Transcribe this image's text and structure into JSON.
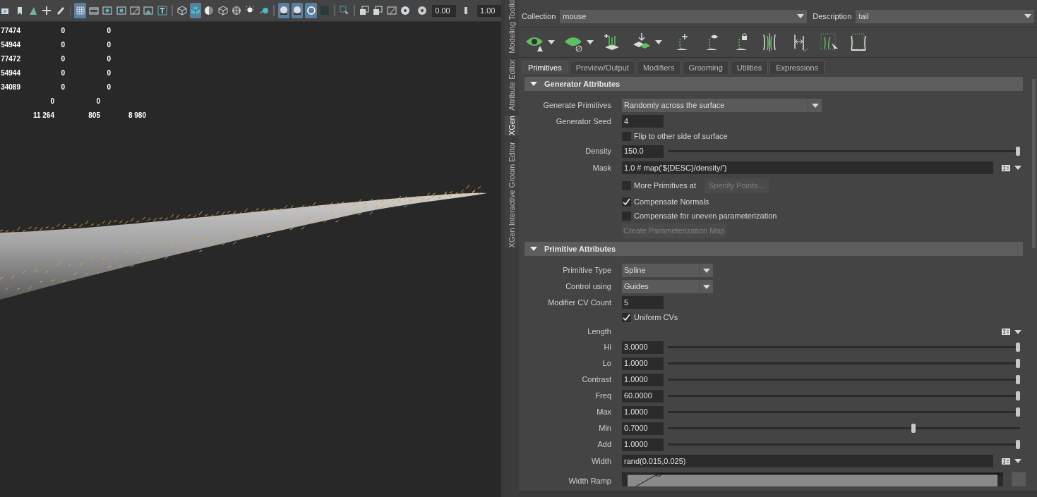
{
  "viewport": {
    "toolbar": {
      "buttons": [
        {
          "kind": "camera",
          "selected": false
        },
        {
          "kind": "bookmark",
          "selected": false
        },
        {
          "kind": "tool",
          "selected": false
        },
        {
          "kind": "move",
          "selected": false
        },
        {
          "kind": "brush",
          "selected": false
        },
        {
          "kind": "grid",
          "selected": true
        },
        {
          "kind": "film",
          "selected": false
        },
        {
          "kind": "dot",
          "selected": false
        },
        {
          "kind": "dot",
          "selected": false
        },
        {
          "kind": "frame",
          "selected": false
        },
        {
          "kind": "image",
          "selected": false
        },
        {
          "kind": "text",
          "selected": false
        },
        {
          "kind": "wire",
          "selected": false
        },
        {
          "kind": "cube",
          "selected": true
        },
        {
          "kind": "half",
          "selected": false
        },
        {
          "kind": "wire",
          "selected": false
        },
        {
          "kind": "checker",
          "selected": false
        },
        {
          "kind": "light",
          "selected": false
        },
        {
          "kind": "ball",
          "selected": false
        },
        {
          "kind": "sphere",
          "selected": true
        },
        {
          "kind": "sphere",
          "selected": true
        },
        {
          "kind": "ring",
          "selected": true
        },
        {
          "kind": "square",
          "selected": false
        },
        {
          "kind": "select",
          "selected": false
        },
        {
          "kind": "copy",
          "selected": false
        },
        {
          "kind": "copy",
          "selected": false
        },
        {
          "kind": "frame",
          "selected": false
        },
        {
          "kind": "aperture",
          "selected": false
        }
      ],
      "fields": [
        "0.00",
        "1.00"
      ]
    },
    "stats": [
      {
        "kind": "object",
        "cells": [
          "77474",
          "0",
          "0"
        ]
      },
      {
        "kind": "object",
        "cells": [
          "54944",
          "0",
          "0"
        ]
      },
      {
        "kind": "object",
        "cells": [
          "77472",
          "0",
          "0"
        ]
      },
      {
        "kind": "object",
        "cells": [
          "54944",
          "0",
          "0"
        ]
      },
      {
        "kind": "object",
        "cells": [
          "34089",
          "0",
          "0"
        ]
      },
      {
        "kind": "summary",
        "cells": [
          "0",
          "0"
        ]
      },
      {
        "kind": "summary",
        "cells": [
          "11 264",
          "805",
          "8 980"
        ]
      }
    ]
  },
  "side_tabs": [
    {
      "label": "Modeling Toolki",
      "selected": false
    },
    {
      "label": "Attribute Editor",
      "selected": false
    },
    {
      "label": "XGen",
      "selected": true
    },
    {
      "label": "XGen Interactive Groom Editor",
      "selected": false
    }
  ],
  "xgen": {
    "collection": {
      "label": "Collection",
      "value": "mouse"
    },
    "description": {
      "label": "Description",
      "value": "tail"
    },
    "toolbar": [
      {
        "kind": "eye",
        "has_menu": true
      },
      {
        "kind": "hide",
        "has_menu": true
      },
      {
        "kind": "addguides",
        "has_menu": false
      },
      {
        "kind": "place",
        "has_menu": true
      },
      {
        "kind": "add",
        "has_menu": false
      },
      {
        "kind": "show",
        "has_menu": false
      },
      {
        "kind": "lock",
        "has_menu": false
      },
      {
        "kind": "split",
        "has_menu": false
      },
      {
        "kind": "swap",
        "has_menu": false
      },
      {
        "kind": "select",
        "has_menu": false
      },
      {
        "kind": "frame",
        "has_menu": false
      }
    ],
    "tabs": [
      {
        "label": "Primitives",
        "selected": true
      },
      {
        "label": "Preview/Output",
        "selected": false
      },
      {
        "label": "Modifiers",
        "selected": false
      },
      {
        "label": "Grooming",
        "selected": false
      },
      {
        "label": "Utilities",
        "selected": false
      },
      {
        "label": "Expressions",
        "selected": false
      }
    ],
    "sections": [
      {
        "title": "Generator Attributes",
        "expanded": true,
        "rows": [
          {
            "kind": "dropdown",
            "label": "Generate Primitives",
            "value": "Randomly across the surface"
          },
          {
            "kind": "number",
            "label": "Generator Seed",
            "value": "4"
          },
          {
            "kind": "checkbox",
            "label": "Flip to other side of surface",
            "checked": false
          },
          {
            "kind": "slider",
            "label": "Density",
            "value": "150.0",
            "level": 1
          },
          {
            "kind": "expression",
            "label": "Mask",
            "value": "1.0 # map('${DESC}/density/')"
          },
          {
            "kind": "checkbox",
            "label": "More Primitives at",
            "checked": false,
            "button": {
              "label": "Specify Points...",
              "disabled": true
            }
          },
          {
            "kind": "checkbox",
            "label": "Compensate Normals",
            "checked": true
          },
          {
            "kind": "checkbox",
            "label": "Compensate for uneven parameterization",
            "checked": false
          },
          {
            "kind": "button",
            "label": "Create Parameterization Map",
            "disabled": true
          }
        ]
      },
      {
        "title": "Primitive Attributes",
        "expanded": true,
        "rows": [
          {
            "kind": "combo",
            "label": "Primitive Type",
            "value": "Spline"
          },
          {
            "kind": "combo",
            "label": "Control using",
            "value": "Guides"
          },
          {
            "kind": "number",
            "label": "Modifier CV Count",
            "value": "5"
          },
          {
            "kind": "checkbox",
            "label": "Uniform CVs",
            "checked": true
          },
          {
            "kind": "heading",
            "label": "Length"
          },
          {
            "kind": "slider",
            "label": "Hi",
            "value": "3.0000",
            "level": 1
          },
          {
            "kind": "slider",
            "label": "Lo",
            "value": "1.0000",
            "level": 1
          },
          {
            "kind": "slider",
            "label": "Contrast",
            "value": "1.0000",
            "level": 1
          },
          {
            "kind": "slider",
            "label": "Freq",
            "value": "60.0000",
            "level": 1
          },
          {
            "kind": "slider",
            "label": "Max",
            "value": "1.0000",
            "level": 1
          },
          {
            "kind": "slider",
            "label": "Min",
            "value": "0.7000",
            "level": 0.7
          },
          {
            "kind": "slider",
            "label": "Add",
            "value": "1.0000",
            "level": 1
          },
          {
            "kind": "expression",
            "label": "Width",
            "value": "rand(0.015,0.025)"
          },
          {
            "kind": "ramp",
            "label": "Width Ramp"
          }
        ]
      }
    ]
  }
}
